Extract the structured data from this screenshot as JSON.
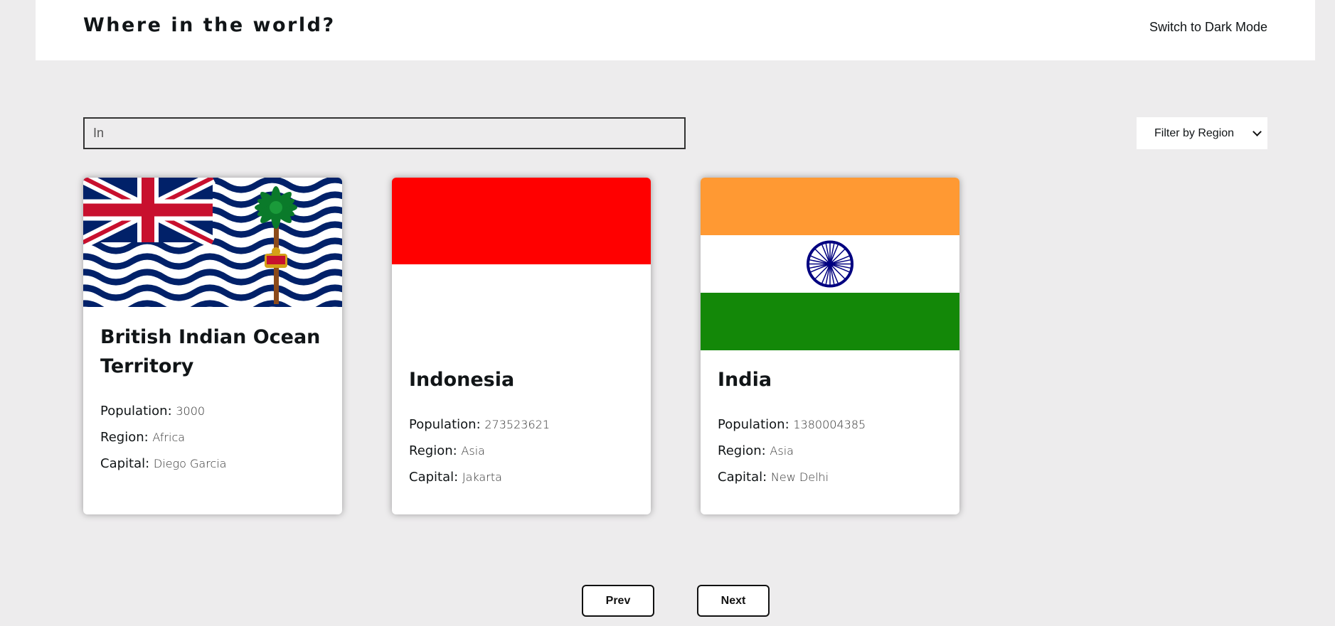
{
  "header": {
    "title": "Where in the world?",
    "mode_toggle_label": "Switch to Dark Mode"
  },
  "search": {
    "value": "In",
    "placeholder": ""
  },
  "filter": {
    "selected": "Filter by Region"
  },
  "labels": {
    "population": "Population:",
    "region": "Region:",
    "capital": "Capital:"
  },
  "countries": [
    {
      "name": "British Indian Ocean Territory",
      "population": "3000",
      "region": "Africa",
      "capital": "Diego Garcia"
    },
    {
      "name": "Indonesia",
      "population": "273523621",
      "region": "Asia",
      "capital": "Jakarta"
    },
    {
      "name": "India",
      "population": "1380004385",
      "region": "Asia",
      "capital": "New Delhi"
    }
  ],
  "pagination": {
    "prev_label": "Prev",
    "next_label": "Next"
  },
  "colors": {
    "background": "#edeced",
    "surface": "#ffffff",
    "text": "#111517",
    "indonesia_red": "#ff0000",
    "india_saffron": "#ff9933",
    "india_green": "#138808",
    "india_chakra": "#000080",
    "biot_navy": "#012169",
    "union_red": "#c8102e"
  }
}
